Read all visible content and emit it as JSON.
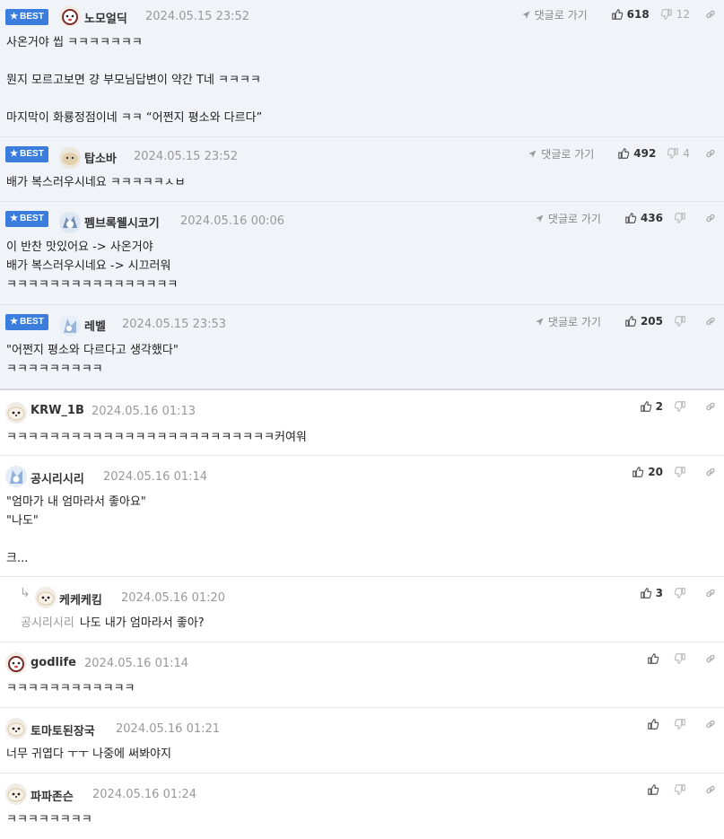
{
  "ui": {
    "best_label": "BEST",
    "reply_link_label": "댓글로 가기"
  },
  "comments": [
    {
      "best": true,
      "nick": "노모얼딕",
      "date": "2024.05.15 23:52",
      "up": "618",
      "down": "12",
      "text": "사온거야 씹 ㅋㅋㅋㅋㅋㅋㅋ\n\n뭔지 모르고보면 걍 부모님답변이 약간 T네 ㅋㅋㅋㅋ\n\n마지막이 화룡정점이네 ㅋㅋ “어쩐지 평소와 다르다”"
    },
    {
      "best": true,
      "nick": "탑소바",
      "date": "2024.05.15 23:52",
      "up": "492",
      "down": "4",
      "text": "배가 복스러우시네요 ㅋㅋㅋㅋㅋㅅㅂ"
    },
    {
      "best": true,
      "nick": "펨브록웰시코기",
      "date": "2024.05.16 00:06",
      "up": "436",
      "down": "",
      "text": "이 반찬 맛있어요 -> 사온거야\n배가 복스러우시네요 -> 시끄러워\nㅋㅋㅋㅋㅋㅋㅋㅋㅋㅋㅋㅋㅋㅋㅋㅋ"
    },
    {
      "best": true,
      "nick": "레벨",
      "date": "2024.05.15 23:53",
      "up": "205",
      "down": "",
      "text": "\"어쩐지 평소와 다르다고 생각했다\"\nㅋㅋㅋㅋㅋㅋㅋㅋㅋ"
    },
    {
      "best": false,
      "nick": "KRW_1B",
      "date": "2024.05.16 01:13",
      "up": "2",
      "down": "",
      "text": "ㅋㅋㅋㅋㅋㅋㅋㅋㅋㅋㅋㅋㅋㅋㅋㅋㅋㅋㅋㅋㅋㅋㅋㅋㅋ커여워"
    },
    {
      "best": false,
      "nick": "공시리시리",
      "date": "2024.05.16 01:14",
      "up": "20",
      "down": "",
      "text": "\"엄마가 내 엄마라서 좋아요\"\n\"나도\"\n\n크..."
    },
    {
      "best": false,
      "reply": true,
      "nick": "케케케킴",
      "date": "2024.05.16 01:20",
      "up": "3",
      "down": "",
      "reply_to": "공시리시리",
      "text": "나도 내가 엄마라서 좋아?"
    },
    {
      "best": false,
      "nick": "godlife",
      "date": "2024.05.16 01:14",
      "up": "",
      "down": "",
      "text": "ㅋㅋㅋㅋㅋㅋㅋㅋㅋㅋㅋㅋ"
    },
    {
      "best": false,
      "nick": "토마토된장국",
      "date": "2024.05.16 01:21",
      "up": "",
      "down": "",
      "text": "너무 귀엽다 ㅜㅜ 나중에 써봐야지"
    },
    {
      "best": false,
      "nick": "파파존슨",
      "date": "2024.05.16 01:24",
      "up": "",
      "down": "",
      "text": "ㅋㅋㅋㅋㅋㅋㅋㅋ"
    }
  ]
}
